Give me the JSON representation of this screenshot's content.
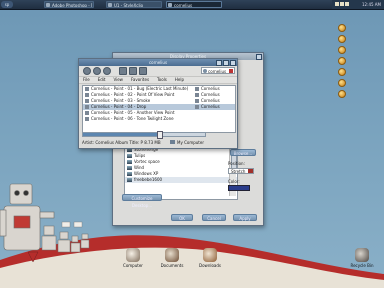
{
  "taskbar": {
    "start_label": "sp",
    "tasks": [
      {
        "label": "Adobe Photoshop - ["
      },
      {
        "label": "U1 - StyleXclio"
      },
      {
        "label": "cornelius"
      }
    ],
    "clock": "12:45 AM"
  },
  "music_window": {
    "title": "cornelius",
    "menu": [
      "File",
      "Edit",
      "View",
      "Favorites",
      "Tools",
      "Help"
    ],
    "search_text": "cornelius",
    "tracks_left": [
      "Cornelius - Point - 01 - Bug (Electric Last Minute)",
      "Cornelius - Point - 02 - Point Of View Point",
      "Cornelius - Point - 03 - Smoke",
      "Cornelius - Point - 04 - Drop",
      "Cornelius - Point - 05 - Another View Point",
      "Cornelius - Point - 06 - Tone Twilight Zone"
    ],
    "selected_track_index": 3,
    "tracks_right": [
      "Cornelius",
      "Cornelius",
      "Cornelius",
      "Cornelius"
    ],
    "progress_fraction": 0.62,
    "status_text": "Artist: Cornelius Album Title: P  8.73 MB",
    "location_text": "My Computer"
  },
  "wallpaper_window": {
    "title": "Display Properties",
    "wallpapers": [
      "Stonehenge",
      "Tulips",
      "Vortec space",
      "Wind",
      "Windows XP",
      "freebebe1600"
    ],
    "selected_wallpaper_index": 5,
    "browse_label": "Browse...",
    "position_label": "Position:",
    "position_value": "Stretch",
    "color_label": "Color:",
    "color_value": "#2a3c8a",
    "customize_label": "Customize Desktop...",
    "ok_label": "OK",
    "cancel_label": "Cancel",
    "apply_label": "Apply"
  },
  "desktop_icons": [
    {
      "label": "Computer"
    },
    {
      "label": "Documents"
    },
    {
      "label": "Downloads"
    },
    {
      "label": "Recycle Bin"
    }
  ],
  "colors": {
    "desktop": "#7aa3be",
    "titlebar": "#4b6d91",
    "selection": "#b8c9db"
  }
}
